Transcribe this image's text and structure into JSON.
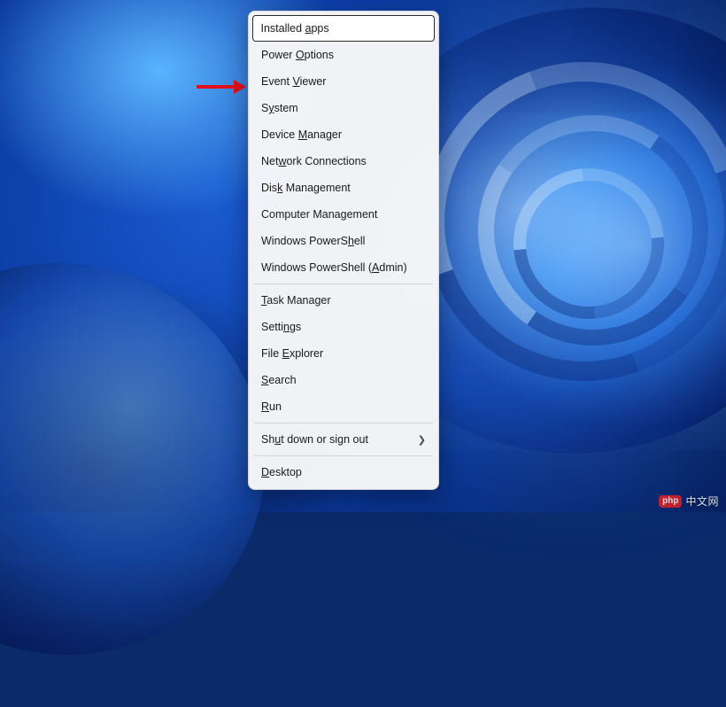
{
  "menu": {
    "items": [
      {
        "pre": "Installed ",
        "key": "a",
        "post": "pps",
        "sub": false
      },
      {
        "pre": "Power ",
        "key": "O",
        "post": "ptions",
        "sub": false
      },
      {
        "pre": "Event ",
        "key": "V",
        "post": "iewer",
        "sub": false
      },
      {
        "pre": "S",
        "key": "y",
        "post": "stem",
        "sub": false
      },
      {
        "pre": "Device ",
        "key": "M",
        "post": "anager",
        "sub": false
      },
      {
        "pre": "Net",
        "key": "w",
        "post": "ork Connections",
        "sub": false
      },
      {
        "pre": "Dis",
        "key": "k",
        "post": " Management",
        "sub": false
      },
      {
        "pre": "Computer Mana",
        "key": "g",
        "post": "ement",
        "sub": false
      },
      {
        "pre": "Windows PowerS",
        "key": "h",
        "post": "ell",
        "sub": false
      },
      {
        "pre": "Windows PowerShell (",
        "key": "A",
        "post": "dmin)",
        "sub": false
      },
      {
        "pre": "",
        "key": "T",
        "post": "ask Manager",
        "sub": false
      },
      {
        "pre": "Setti",
        "key": "n",
        "post": "gs",
        "sub": false
      },
      {
        "pre": "File ",
        "key": "E",
        "post": "xplorer",
        "sub": false
      },
      {
        "pre": "",
        "key": "S",
        "post": "earch",
        "sub": false
      },
      {
        "pre": "",
        "key": "R",
        "post": "un",
        "sub": false
      },
      {
        "pre": "Sh",
        "key": "u",
        "post": "t down or sign out",
        "sub": true
      },
      {
        "pre": "",
        "key": "D",
        "post": "esktop",
        "sub": false
      }
    ],
    "highlighted_index": 0,
    "pointed_index": 2,
    "separators_after": [
      9,
      14,
      15
    ]
  },
  "watermark": {
    "badge": "php",
    "text": "中文网"
  },
  "colors": {
    "arrow": "#e1101a",
    "menu_bg": "#f8f8f8",
    "highlight_border": "#2a2a2a"
  }
}
